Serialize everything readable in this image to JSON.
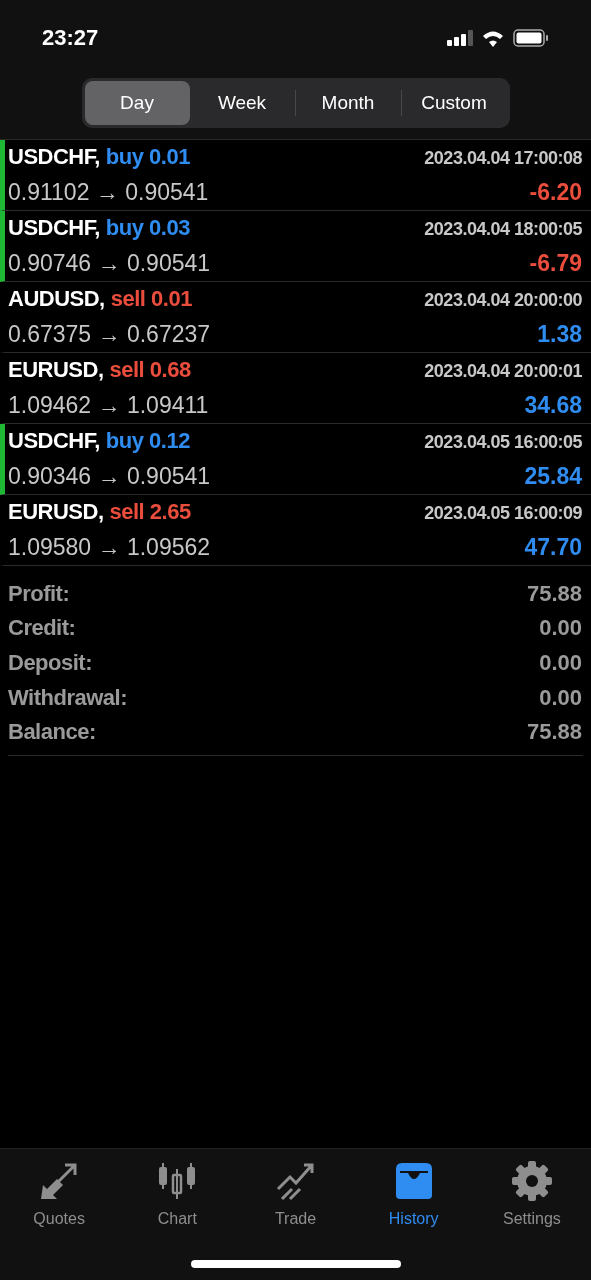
{
  "status_bar": {
    "time": "23:27"
  },
  "segments": [
    {
      "label": "Day",
      "selected": true
    },
    {
      "label": "Week",
      "selected": false
    },
    {
      "label": "Month",
      "selected": false
    },
    {
      "label": "Custom",
      "selected": false
    }
  ],
  "deals": [
    {
      "symbol": "USDCHF,",
      "side": "buy",
      "volume": "0.01",
      "time": "2023.04.04 17:00:08",
      "prices": "0.91102 → 0.90541",
      "profit": "-6.20",
      "loss": true
    },
    {
      "symbol": "USDCHF,",
      "side": "buy",
      "volume": "0.03",
      "time": "2023.04.04 18:00:05",
      "prices": "0.90746 → 0.90541",
      "profit": "-6.79",
      "loss": true
    },
    {
      "symbol": "AUDUSD,",
      "side": "sell",
      "volume": "0.01",
      "time": "2023.04.04 20:00:00",
      "prices": "0.67375 → 0.67237",
      "profit": "1.38",
      "loss": false
    },
    {
      "symbol": "EURUSD,",
      "side": "sell",
      "volume": "0.68",
      "time": "2023.04.04 20:00:01",
      "prices": "1.09462 → 1.09411",
      "profit": "34.68",
      "loss": false
    },
    {
      "symbol": "USDCHF,",
      "side": "buy",
      "volume": "0.12",
      "time": "2023.04.05 16:00:05",
      "prices": "0.90346 → 0.90541",
      "profit": "25.84",
      "loss": false
    },
    {
      "symbol": "EURUSD,",
      "side": "sell",
      "volume": "2.65",
      "time": "2023.04.05 16:00:09",
      "prices": "1.09580 → 1.09562",
      "profit": "47.70",
      "loss": false
    }
  ],
  "summary": [
    {
      "label": "Profit:",
      "value": "75.88"
    },
    {
      "label": "Credit:",
      "value": "0.00"
    },
    {
      "label": "Deposit:",
      "value": "0.00"
    },
    {
      "label": "Withdrawal:",
      "value": "0.00"
    },
    {
      "label": "Balance:",
      "value": "75.88"
    }
  ],
  "tab_bar": [
    {
      "kind": "quotes",
      "label": "Quotes",
      "selected": false
    },
    {
      "kind": "chart",
      "label": "Chart",
      "selected": false
    },
    {
      "kind": "trade",
      "label": "Trade",
      "selected": false
    },
    {
      "kind": "history",
      "label": "History",
      "selected": true
    },
    {
      "kind": "settings",
      "label": "Settings",
      "selected": false
    }
  ]
}
